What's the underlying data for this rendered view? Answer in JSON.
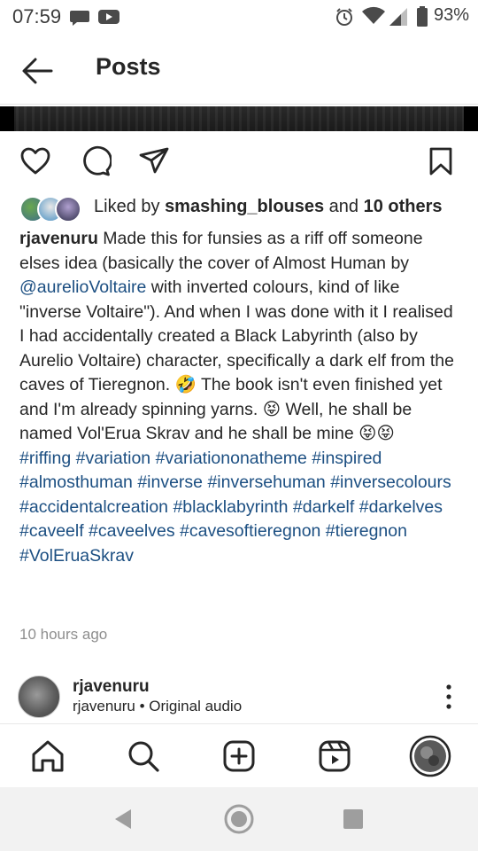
{
  "status_bar": {
    "time": "07:59",
    "battery": "93%"
  },
  "header": {
    "title": "Posts"
  },
  "post": {
    "likes": {
      "prefix": "Liked by ",
      "user": "smashing_blouses",
      "middle": " and ",
      "others": "10 others"
    },
    "caption": {
      "username": "rjavenuru",
      "text_1": " Made this for funsies as a riff off someone elses idea (basically the cover of Almost Human by ",
      "mention": "@aurelioVoltaire",
      "text_2": " with inverted colours, kind of like \"inverse Voltaire\"). And when I was done with it I realised I had accidentally created a Black Labyrinth (also by Aurelio Voltaire) character, specifically a dark elf from the caves of Tieregnon. ",
      "emoji_1": "🤣",
      "text_3": " The book isn't even finished yet and I'm already spinning yarns. ",
      "emoji_2": "😝",
      "text_4": " Well, he shall be named Vol'Erua Skrav and he shall be mine ",
      "emoji_3": "😝😝"
    },
    "hashtags": "#riffing #variation #variationonatheme #inspired #almosthuman #inverse #inversehuman #inversecolours #accidentalcreation #blacklabyrinth #darkelf #darkelves #caveelf #caveelves #cavesoftieregnon #tieregnon #VolEruaSkrav",
    "timestamp": "10 hours ago"
  },
  "reel": {
    "username": "rjavenuru",
    "subtitle": "rjavenuru • Original audio"
  },
  "colors": {
    "text": "#262626",
    "link": "#1c4f82",
    "muted": "#8e8e8e"
  },
  "icons": {
    "actions": [
      "heart-icon",
      "comment-icon",
      "share-icon",
      "bookmark-icon"
    ],
    "nav": [
      "home-icon",
      "search-icon",
      "new-post-icon",
      "reels-icon",
      "profile-avatar"
    ],
    "system": [
      "back-triangle-icon",
      "home-circle-icon",
      "recents-square-icon"
    ]
  }
}
